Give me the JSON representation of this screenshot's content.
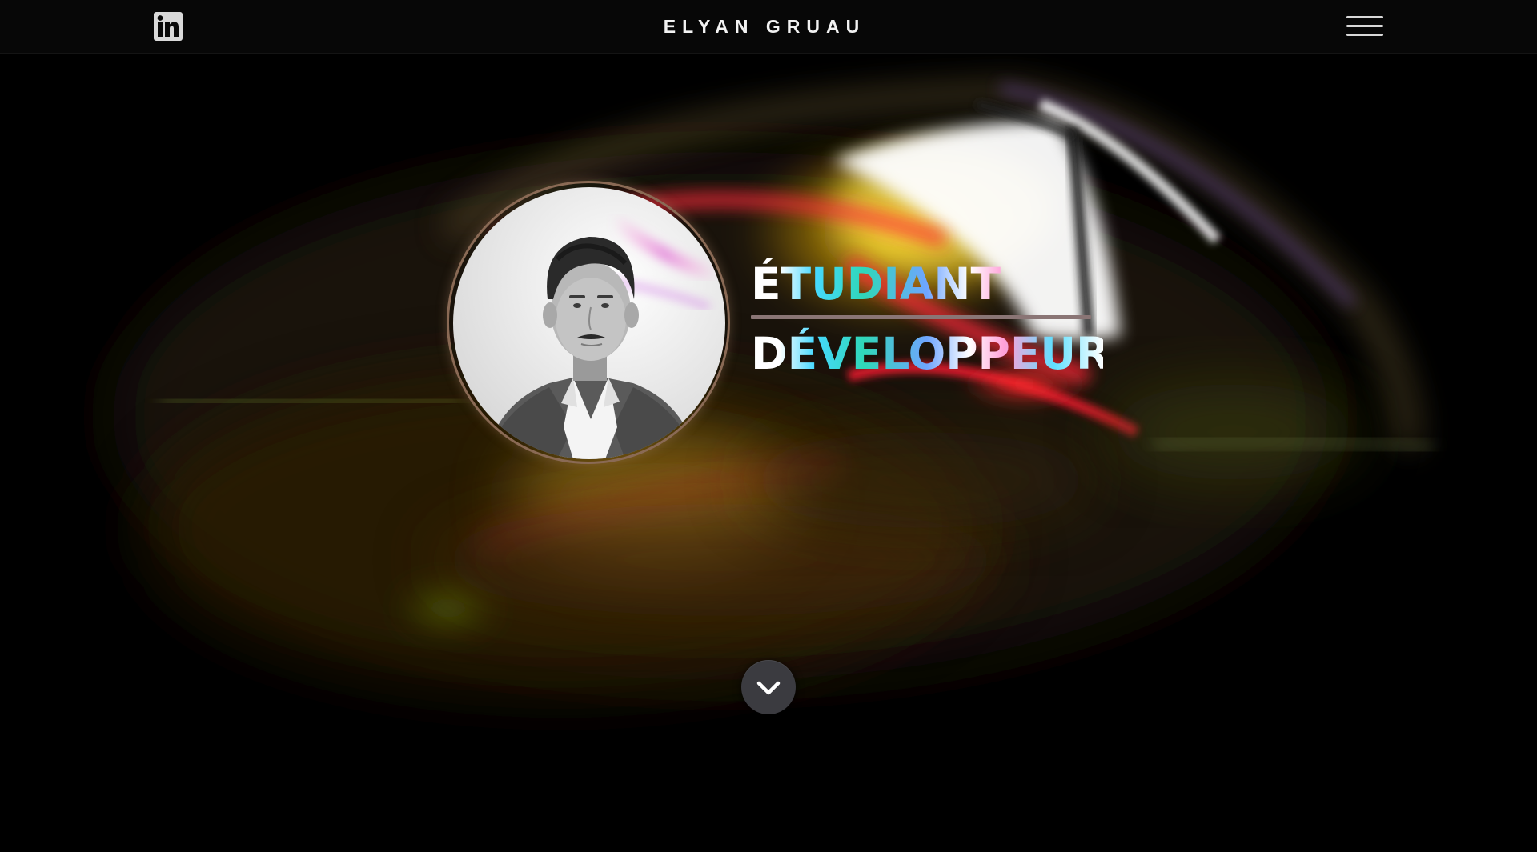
{
  "header": {
    "title": "ELYAN GRUAU",
    "linkedin_icon": "linkedin-icon",
    "menu_icon": "hamburger-menu-icon"
  },
  "hero": {
    "line1": "ÉTUDIANT",
    "line2": "DÉVELOPPEUR",
    "avatar_icon": "profile-photo",
    "scroll_icon": "chevron-down-icon"
  },
  "colors": {
    "background": "#000000",
    "ring": "#8a6a55",
    "divider": "#8a7575",
    "accent_cyan": "#47d9ff",
    "accent_pink": "#ff9fd8"
  }
}
